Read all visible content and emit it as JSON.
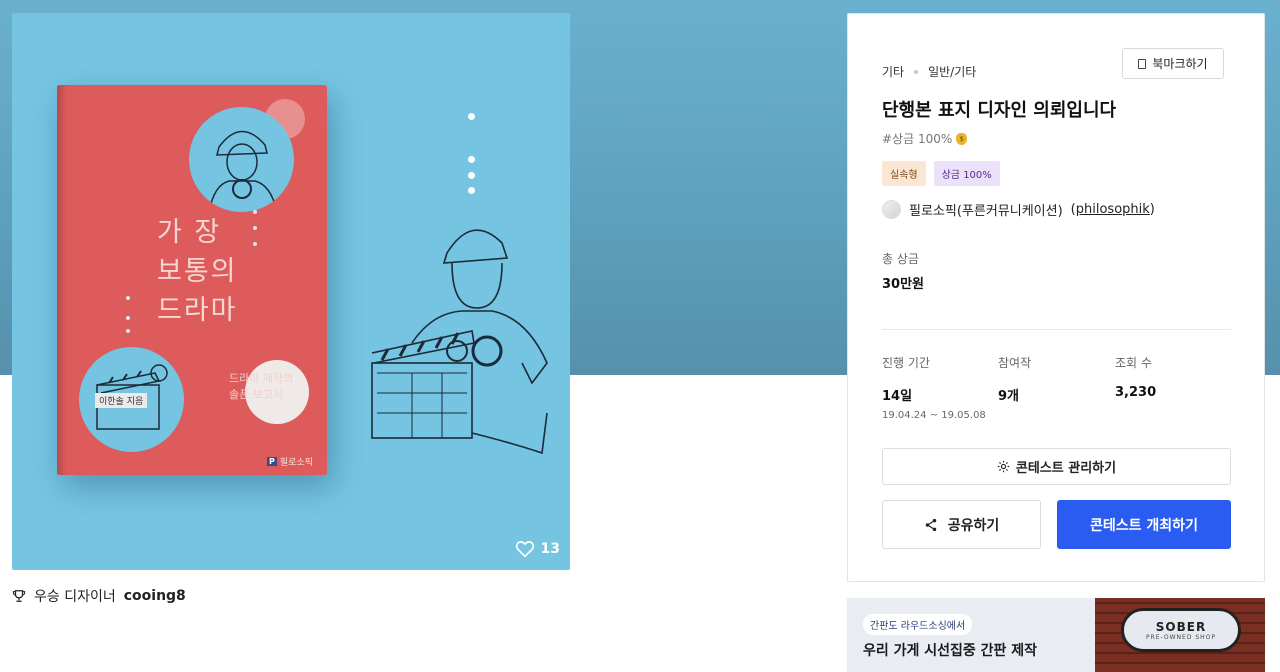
{
  "artwork": {
    "book_title_lines": [
      "가  장",
      "보통의",
      "드라마"
    ],
    "book_subtitle_lines": [
      "드라마 제작의",
      "솔픈 보고서"
    ],
    "author_label": "이한솔 지음",
    "publisher_mark": "P",
    "publisher_name": "필로소픽",
    "like_count": "13"
  },
  "winner": {
    "prefix": "우승 디자이너",
    "name": "cooing8"
  },
  "contest": {
    "category": "기타",
    "subcategory": "일반/기타",
    "bookmark_label": "북마크하기",
    "title": "단행본 표지 디자인 의뢰입니다",
    "tagline": "#상금 100%",
    "badges": [
      {
        "label": "실속형",
        "color": "#fbe6d3"
      },
      {
        "label": "상금 100%",
        "color": "#ebe1fb"
      }
    ],
    "owner_name": "필로소픽(푸른커뮤니케이션)",
    "owner_id": "philosophik",
    "prize_label": "총 상금",
    "prize_value": "30만원",
    "stats": {
      "period_label": "진행 기간",
      "period_value": "14일",
      "period_range": "19.04.24 ~ 19.05.08",
      "entries_label": "참여작",
      "entries_value": "9개",
      "views_label": "조회 수",
      "views_value": "3,230"
    },
    "manage_label": "콘테스트 관리하기",
    "share_label": "공유하기",
    "host_label": "콘테스트 개최하기",
    "accent_color": "#2a5cf2"
  },
  "ad": {
    "kicker": "간판도 라우드소싱에서",
    "headline": "우리 가게 시선집중 간판 제작",
    "sign_brand": "SOBER",
    "sign_sub": "PRE-OWNED SHOP"
  }
}
